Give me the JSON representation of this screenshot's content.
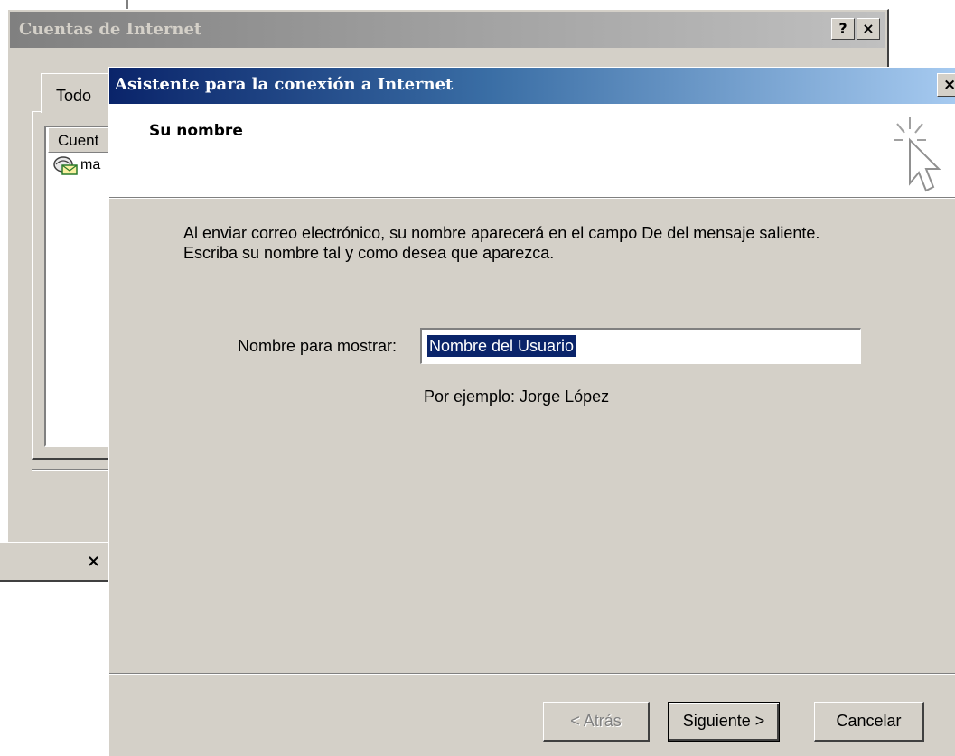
{
  "background_window": {
    "title": "Cuentas de Internet",
    "help_button": "?",
    "close_button": "×",
    "tab_label": "Todo",
    "list_header": "Cuent",
    "list_item": "ma",
    "strip_close": "×"
  },
  "wizard": {
    "title": "Asistente para la conexión a Internet",
    "close_button": "×",
    "header_title": "Su nombre",
    "intro_text": "Al enviar correo electrónico, su nombre aparecerá en el campo De del mensaje saliente. Escriba su nombre tal y como desea que aparezca.",
    "field_label": "Nombre para mostrar:",
    "field_value": "Nombre del Usuario",
    "example_text": "Por ejemplo: Jorge López",
    "buttons": {
      "back": "< Atrás",
      "next": "Siguiente >",
      "cancel": "Cancelar"
    }
  },
  "colors": {
    "titlebar_active": "#0a246a",
    "titlebar_inactive": "#808080",
    "face": "#d4d0c8",
    "selection": "#0a246a"
  }
}
